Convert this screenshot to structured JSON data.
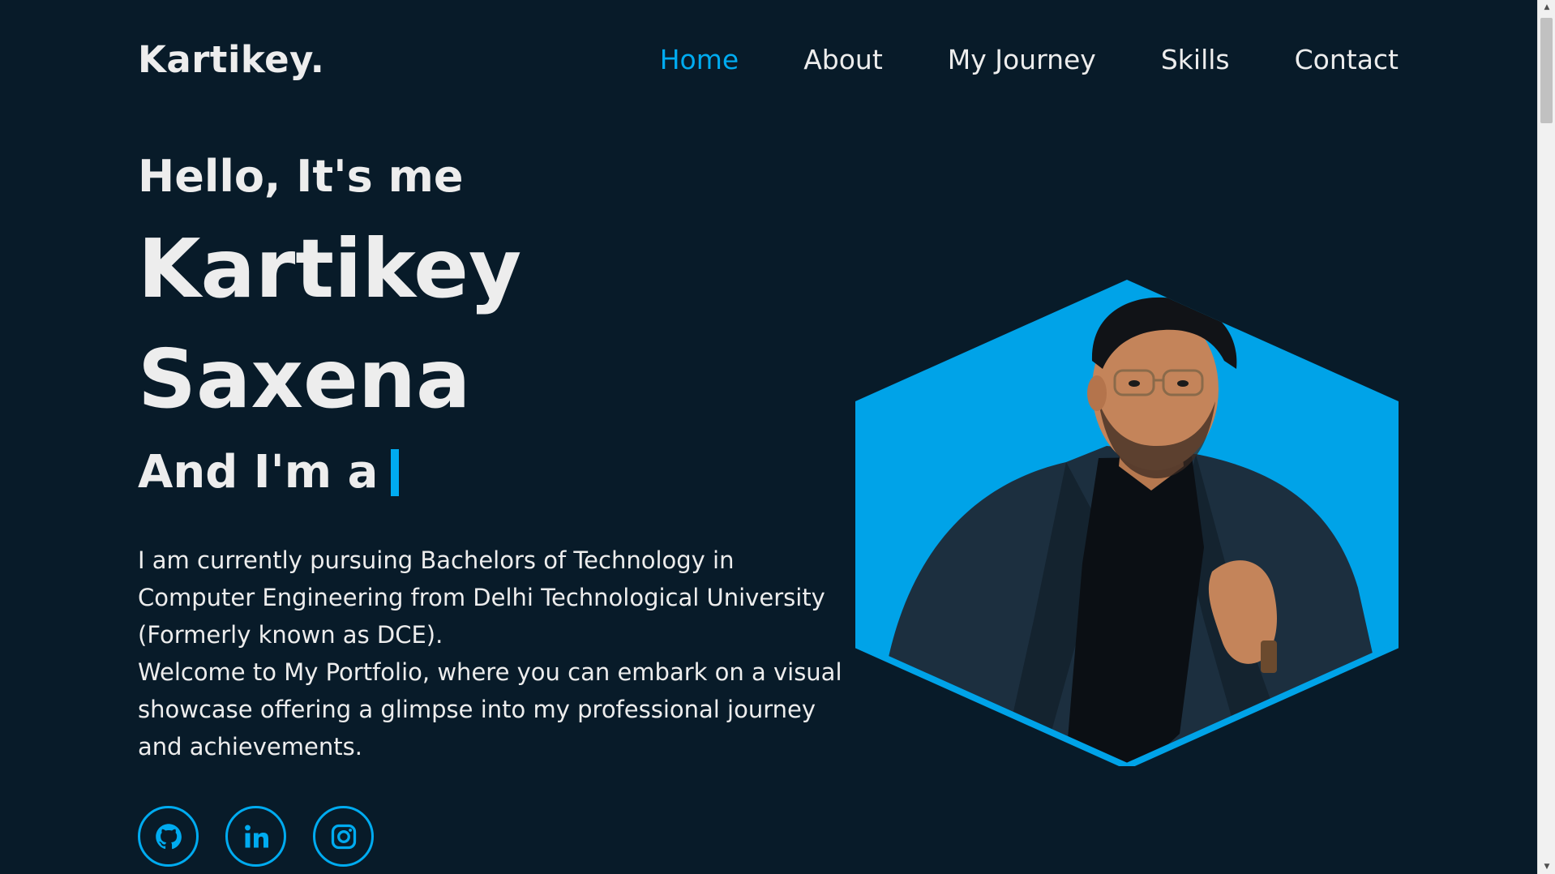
{
  "header": {
    "logo": "Kartikey.",
    "nav": [
      {
        "label": "Home",
        "active": true
      },
      {
        "label": "About",
        "active": false
      },
      {
        "label": "My Journey",
        "active": false
      },
      {
        "label": "Skills",
        "active": false
      },
      {
        "label": "Contact",
        "active": false
      }
    ]
  },
  "hero": {
    "greeting": "Hello, It's me",
    "first_name": "Kartikey",
    "last_name": "Saxena",
    "role_prefix": "And I'm a",
    "description_line1": "I am currently pursuing Bachelors of Technology in Computer Engineering from Delhi Technological University (Formerly known as DCE).",
    "description_line2": "Welcome to My Portfolio, where you can embark on a visual showcase offering a glimpse into my professional journey and achievements."
  },
  "socials": [
    {
      "icon": "github-icon"
    },
    {
      "icon": "linkedin-icon"
    },
    {
      "icon": "instagram-icon"
    }
  ],
  "colors": {
    "background": "#081b29",
    "accent": "#00abf0",
    "text": "#ededed"
  }
}
